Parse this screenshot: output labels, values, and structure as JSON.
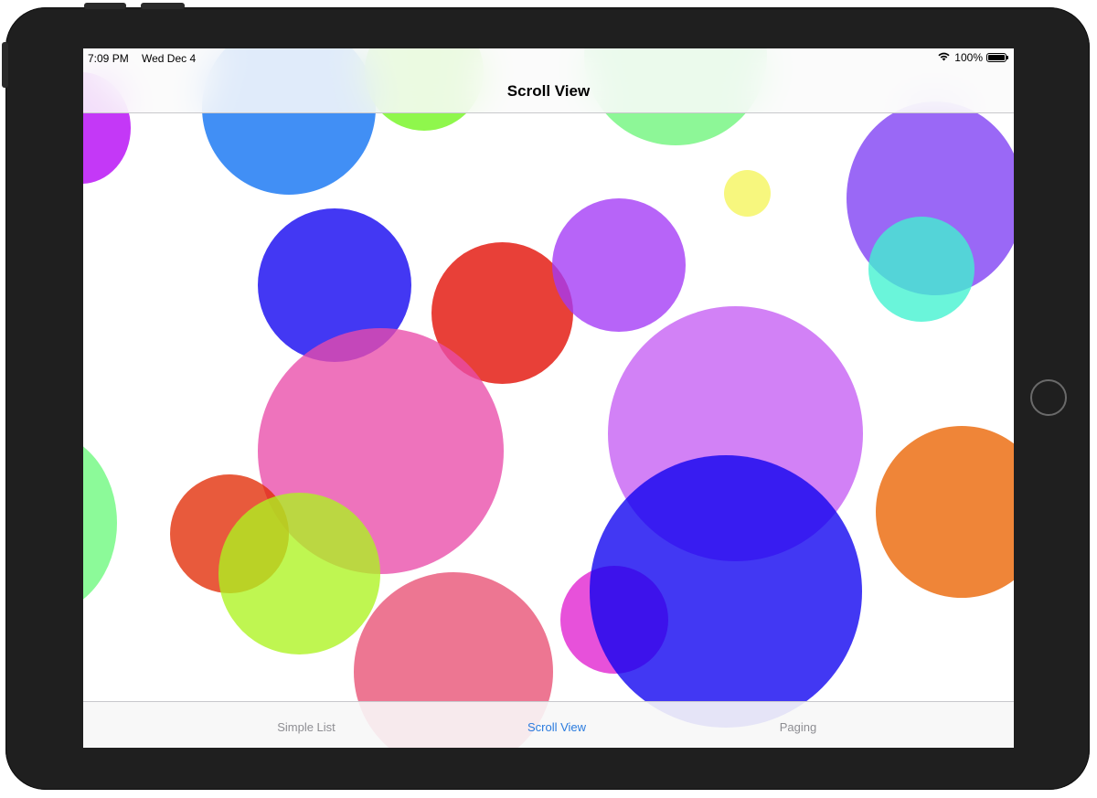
{
  "status_bar": {
    "time": "7:09 PM",
    "date": "Wed Dec 4",
    "battery": "100%",
    "wifi_icon": "wifi-icon",
    "battery_icon": "battery-icon"
  },
  "nav": {
    "title": "Scroll View"
  },
  "tabs": [
    {
      "label": "Simple List",
      "selected": false
    },
    {
      "label": "Scroll View",
      "selected": true
    },
    {
      "label": "Paging",
      "selected": false
    }
  ],
  "colors": {
    "tab_active": "#2a7bde",
    "tab_inactive": "#8e8e93"
  }
}
